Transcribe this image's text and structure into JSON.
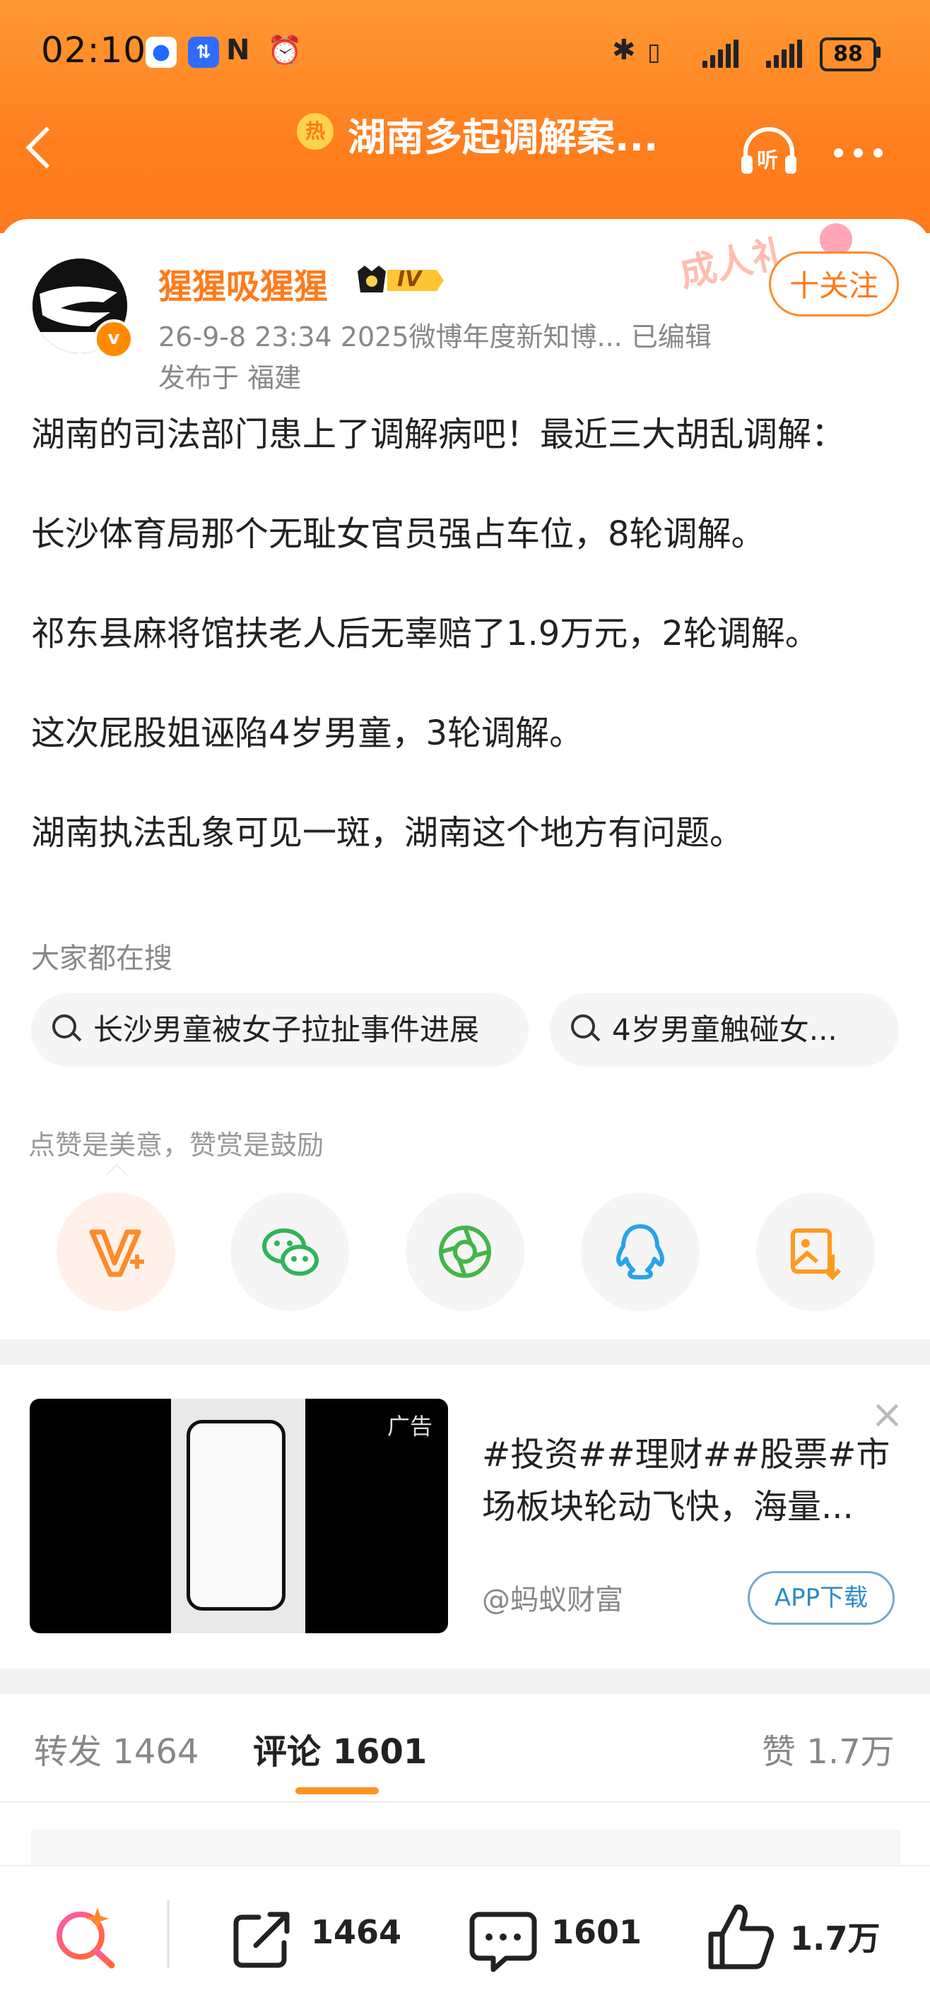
{
  "status_bar": {
    "time": "02:10",
    "battery": "88",
    "icons": [
      "app-icon",
      "data-transfer-icon",
      "nfc-icon",
      "alarm-icon",
      "bluetooth-icon",
      "vibrate-icon",
      "signal-icon",
      "signal-icon"
    ]
  },
  "header": {
    "hot_badge": "热",
    "title": "湖南多起调解案...",
    "listen_label": "听"
  },
  "post": {
    "author": "猩猩吸猩猩",
    "level": "IV",
    "verified_badge": "v",
    "meta": "26-9-8 23:34  2025微博年度新知博...  已编辑",
    "location": "发布于 福建",
    "decoration": "成人礼",
    "follow_label": "十关注",
    "paragraphs": [
      "湖南的司法部门患上了调解病吧！最近三大胡乱调解：",
      "长沙体育局那个无耻女官员强占车位，8轮调解。",
      "祁东县麻将馆扶老人后无辜赔了1.9万元，2轮调解。",
      "这次屁股姐诬陷4岁男童，3轮调解。",
      "湖南执法乱象可见一斑，湖南这个地方有问题。"
    ]
  },
  "search": {
    "label": "大家都在搜",
    "chips": [
      "长沙男童被女子拉扯事件进展",
      "4岁男童触碰女..."
    ]
  },
  "reward": {
    "tip": "点赞是美意，赞赏是鼓励"
  },
  "share_buttons": [
    "v-plus-icon",
    "wechat-icon",
    "moments-icon",
    "qq-icon",
    "save-image-icon"
  ],
  "ad": {
    "tag": "广告",
    "title": "#投资##理财##股票#市场板块轮动飞快，海量...",
    "brand": "@蚂蚁财富",
    "button": "APP下载",
    "close": "×"
  },
  "tabs": {
    "repost_label": "转发",
    "repost_count": "1464",
    "comment_label": "评论",
    "comment_count": "1601",
    "like_label": "赞",
    "like_count": "1.7万"
  },
  "bottom_bar": {
    "share_count": "1464",
    "comment_count": "1601",
    "like_count": "1.7万"
  },
  "colors": {
    "accent": "#ff7a1a",
    "header_gradient_top": "#ff9933",
    "link_blue": "#2f8ac8"
  }
}
